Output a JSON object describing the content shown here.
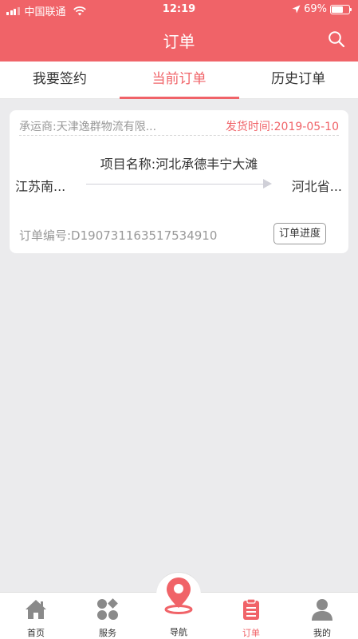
{
  "status_bar": {
    "carrier": "中国联通",
    "time": "12:19",
    "battery": "69%",
    "battery_level": 0.69
  },
  "header": {
    "title": "订单",
    "search_icon": "search-icon"
  },
  "tabs": [
    {
      "label": "我要签约",
      "active": false
    },
    {
      "label": "当前订单",
      "active": true
    },
    {
      "label": "历史订单",
      "active": false
    }
  ],
  "order": {
    "carrier": "承运商:天津逸群物流有限...",
    "ship_time": "发货时间:2019-05-10",
    "project": "项目名称:河北承德丰宁大滩",
    "origin": "江苏南...",
    "destination": "河北省...",
    "order_no": "订单编号:D190731163517534910",
    "progress_button": "订单进度"
  },
  "tabbar": [
    {
      "label": "首页",
      "icon": "home-icon",
      "active": false
    },
    {
      "label": "服务",
      "icon": "services-icon",
      "active": false
    },
    {
      "label": "导航",
      "icon": "location-pin-icon",
      "active": false
    },
    {
      "label": "订单",
      "icon": "clipboard-icon",
      "active": true
    },
    {
      "label": "我的",
      "icon": "user-icon",
      "active": false
    }
  ],
  "colors": {
    "accent": "#f06368",
    "background": "#ebebed",
    "icon_gray": "#8a8a8a"
  }
}
